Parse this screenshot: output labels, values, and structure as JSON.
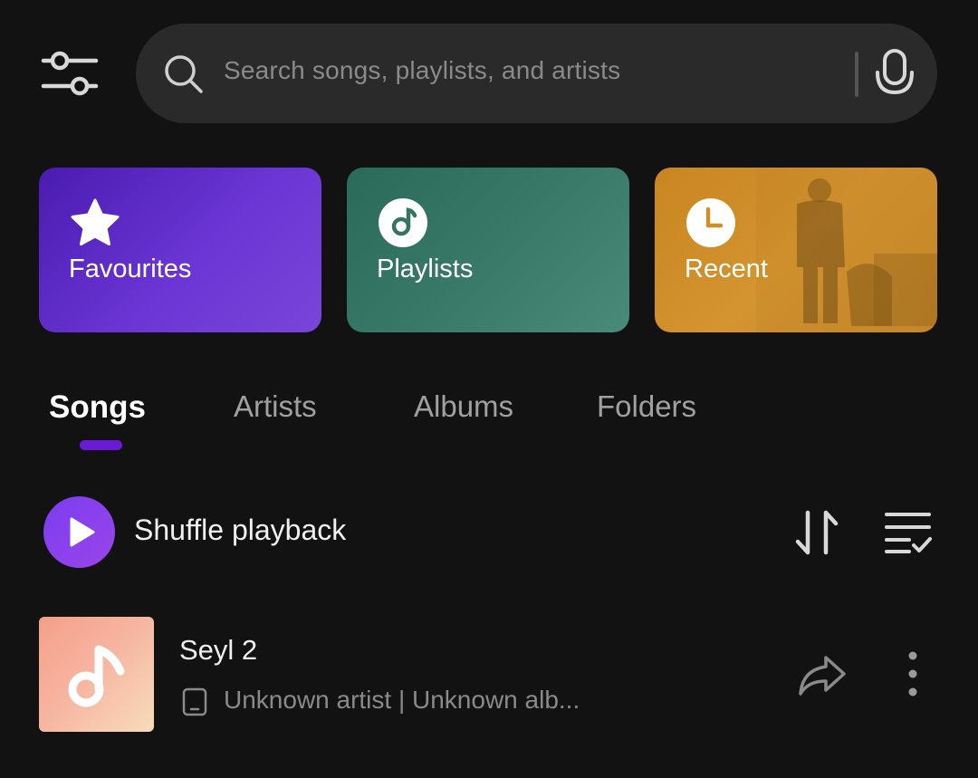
{
  "search": {
    "placeholder": "Search songs, playlists, and artists"
  },
  "cards": [
    {
      "label": "Favourites",
      "icon": "star-icon",
      "color": "#5a25c4"
    },
    {
      "label": "Playlists",
      "icon": "music-disc-icon",
      "color": "#357462"
    },
    {
      "label": "Recent",
      "icon": "clock-icon",
      "color": "#d08e28"
    }
  ],
  "tabs": [
    {
      "label": "Songs",
      "active": true
    },
    {
      "label": "Artists",
      "active": false
    },
    {
      "label": "Albums",
      "active": false
    },
    {
      "label": "Folders",
      "active": false
    }
  ],
  "shuffle": {
    "label": "Shuffle playback"
  },
  "songs": [
    {
      "title": "Seyl 2",
      "meta": "Unknown artist | Unknown alb..."
    }
  ],
  "colors": {
    "background": "#121212",
    "accent": "#6a1ad4",
    "search_bg": "#2a2a2a"
  }
}
